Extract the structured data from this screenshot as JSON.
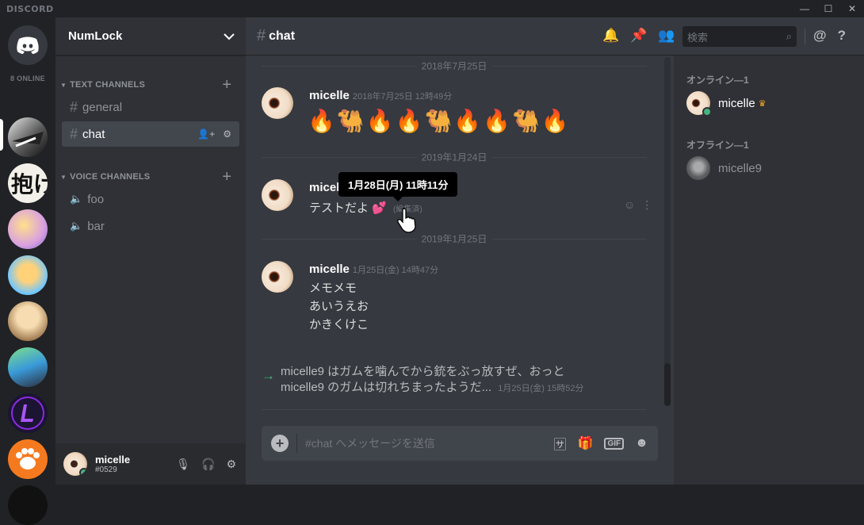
{
  "app": {
    "brand": "DISCORD",
    "online_count": "8 ONLINE"
  },
  "window_controls": {
    "minimize": "—",
    "maximize": "☐",
    "close": "✕"
  },
  "server": {
    "name": "NumLock"
  },
  "categories": {
    "text": "TEXT CHANNELS",
    "voice": "VOICE CHANNELS"
  },
  "text_channels": [
    {
      "name": "general"
    },
    {
      "name": "chat"
    }
  ],
  "voice_channels": [
    {
      "name": "foo"
    },
    {
      "name": "bar"
    }
  ],
  "user_panel": {
    "name": "micelle",
    "tag": "#0529"
  },
  "header": {
    "channel": "chat",
    "search_placeholder": "検索"
  },
  "dividers": [
    "2018年7月25日",
    "2019年1月24日",
    "2019年1月25日"
  ],
  "messages": [
    {
      "author": "micelle",
      "timestamp": "2018年7月25日 12時49分",
      "emoji": "🔥🐫🔥🔥🐫🔥🔥🐫🔥"
    },
    {
      "author": "micelle",
      "text": "テストだよ",
      "emoji": "💕",
      "edited": "(編集済)",
      "tooltip": "1月28日(月) 11時11分"
    },
    {
      "author": "micelle",
      "timestamp": "1月25日(金) 14時47分",
      "lines": [
        "メモメモ",
        "あいうえお",
        "かきくけこ"
      ]
    }
  ],
  "system_message": {
    "line1": "micelle9 はガムを噛んでから銃をぶっ放すぜ、おっと",
    "line2": "micelle9 のガムは切れちまったようだ...",
    "timestamp": "1月25日(金) 15時52分"
  },
  "composer": {
    "placeholder": "#chat へメッセージを送信"
  },
  "members": {
    "online_header": "オンライン—1",
    "offline_header": "オフライン—1",
    "online": [
      {
        "name": "micelle",
        "crown": "♛"
      }
    ],
    "offline": [
      {
        "name": "micelle9"
      }
    ]
  },
  "colors": {
    "accent": "#7289da",
    "online": "#43b581",
    "bg_main": "#36393f",
    "bg_sidebar": "#2f3136"
  }
}
